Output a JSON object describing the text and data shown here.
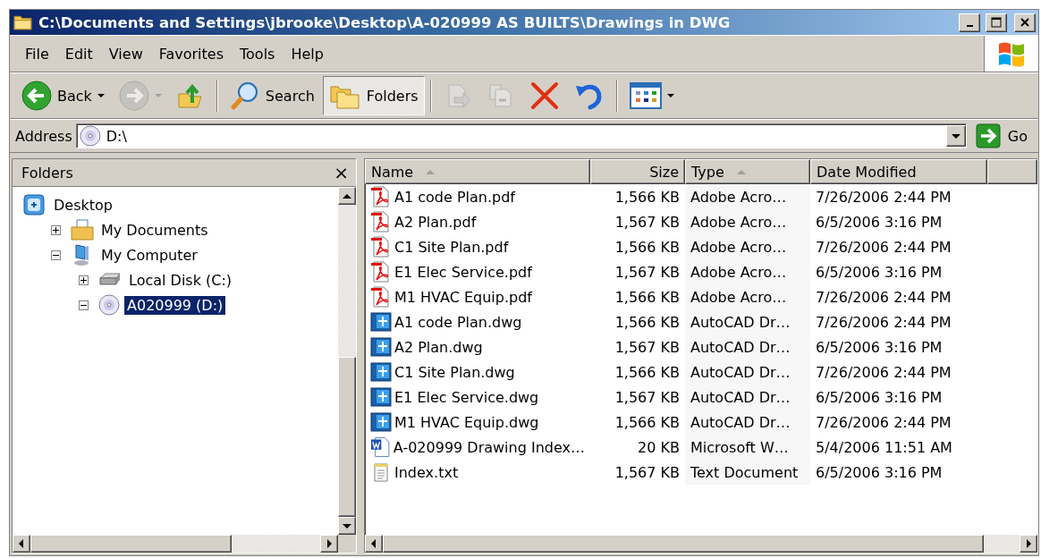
{
  "window": {
    "title": "C:\\Documents and Settings\\jbrooke\\Desktop\\A-020999 AS BUILTS\\Drawings in DWG"
  },
  "menu": [
    "File",
    "Edit",
    "View",
    "Favorites",
    "Tools",
    "Help"
  ],
  "toolbar": {
    "groups": [
      {
        "buttons": [
          {
            "kind": "back",
            "label": "Back",
            "dropdown": true,
            "disabled": false,
            "selected": false
          },
          {
            "kind": "forward",
            "dropdown": true,
            "disabled": true,
            "selected": false
          },
          {
            "kind": "up",
            "dropdown": false,
            "disabled": false,
            "selected": false
          }
        ]
      },
      {
        "buttons": [
          {
            "kind": "search",
            "label": "Search",
            "dropdown": false,
            "disabled": false,
            "selected": false
          },
          {
            "kind": "folders",
            "label": "Folders",
            "dropdown": false,
            "disabled": false,
            "selected": true
          }
        ]
      },
      {
        "buttons": [
          {
            "kind": "move",
            "dropdown": false,
            "disabled": true,
            "selected": false
          },
          {
            "kind": "copy",
            "dropdown": false,
            "disabled": true,
            "selected": false
          },
          {
            "kind": "delete",
            "dropdown": false,
            "disabled": false,
            "selected": false
          },
          {
            "kind": "undo",
            "dropdown": false,
            "disabled": false,
            "selected": false
          }
        ]
      },
      {
        "buttons": [
          {
            "kind": "views",
            "dropdown": true,
            "disabled": false,
            "selected": false
          }
        ]
      }
    ]
  },
  "address": {
    "label": "Address",
    "value": "D:\\",
    "go": "Go"
  },
  "folders_pane": {
    "title": "Folders",
    "close": "×",
    "tree": [
      {
        "label": "Desktop",
        "kind": "desktop",
        "selected": false,
        "children": [
          {
            "label": "My Documents",
            "kind": "documents",
            "expanded": false,
            "selected": false
          },
          {
            "label": "My Computer",
            "kind": "computer",
            "expanded": true,
            "selected": false,
            "children": [
              {
                "label": "Local Disk (C:)",
                "kind": "disk",
                "expanded": false,
                "selected": false
              },
              {
                "label": "A020999 (D:)",
                "kind": "cd",
                "expanded": true,
                "selected": true
              }
            ]
          }
        ]
      }
    ]
  },
  "files": {
    "columns": [
      {
        "label": "Name",
        "sorted": true
      },
      {
        "label": "Size",
        "sorted": false
      },
      {
        "label": "Type",
        "sorted": true
      },
      {
        "label": "Date Modified",
        "sorted": false
      }
    ],
    "rows": [
      {
        "kind": "pdf",
        "name": "A1 code Plan.pdf",
        "size": "1,566 KB",
        "type": "Adobe Acro…",
        "date": "7/26/2006 2:44 PM"
      },
      {
        "kind": "pdf",
        "name": "A2 Plan.pdf",
        "size": "1,567 KB",
        "type": "Adobe Acro…",
        "date": "6/5/2006 3:16 PM"
      },
      {
        "kind": "pdf",
        "name": "C1 Site Plan.pdf",
        "size": "1,566 KB",
        "type": "Adobe Acro…",
        "date": "7/26/2006 2:44 PM"
      },
      {
        "kind": "pdf",
        "name": "E1 Elec Service.pdf",
        "size": "1,567 KB",
        "type": "Adobe Acro…",
        "date": "6/5/2006 3:16 PM"
      },
      {
        "kind": "pdf",
        "name": "M1 HVAC Equip.pdf",
        "size": "1,566 KB",
        "type": "Adobe Acro…",
        "date": "7/26/2006 2:44 PM"
      },
      {
        "kind": "dwg",
        "name": "A1 code Plan.dwg",
        "size": "1,566 KB",
        "type": "AutoCAD Dr…",
        "date": "7/26/2006 2:44 PM"
      },
      {
        "kind": "dwg",
        "name": "A2 Plan.dwg",
        "size": "1,567 KB",
        "type": "AutoCAD Dr…",
        "date": "6/5/2006 3:16 PM"
      },
      {
        "kind": "dwg",
        "name": "C1 Site Plan.dwg",
        "size": "1,566 KB",
        "type": "AutoCAD Dr…",
        "date": "7/26/2006 2:44 PM"
      },
      {
        "kind": "dwg",
        "name": "E1 Elec Service.dwg",
        "size": "1,567 KB",
        "type": "AutoCAD Dr…",
        "date": "6/5/2006 3:16 PM"
      },
      {
        "kind": "dwg",
        "name": "M1 HVAC Equip.dwg",
        "size": "1,566 KB",
        "type": "AutoCAD Dr…",
        "date": "7/26/2006 2:44 PM"
      },
      {
        "kind": "doc",
        "name": "A-020999 Drawing Index…",
        "size": "20 KB",
        "type": "Microsoft W…",
        "date": "5/4/2006 11:51 AM"
      },
      {
        "kind": "txt",
        "name": "Index.txt",
        "size": "1,567 KB",
        "type": "Text Document",
        "date": "6/5/2006 3:16 PM"
      }
    ]
  }
}
